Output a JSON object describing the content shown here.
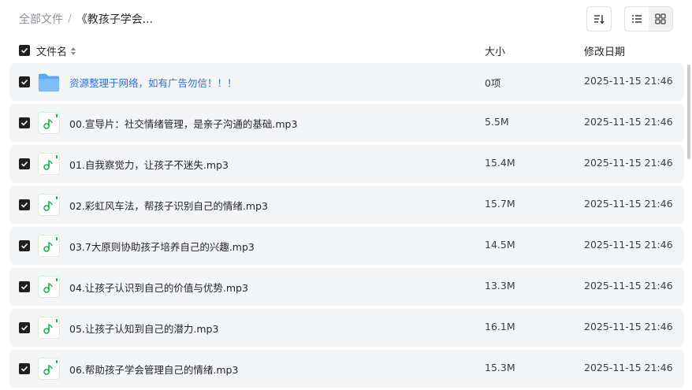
{
  "breadcrumb": {
    "root": "全部文件",
    "separator": "/",
    "current": "《教孩子学会..."
  },
  "toolbar": {
    "sort_icon": "sort-icon",
    "list_view_icon": "list-view-icon",
    "grid_view_icon": "grid-view-icon"
  },
  "columns": {
    "name": "文件名",
    "size": "大小",
    "date": "修改日期"
  },
  "files": [
    {
      "name": "资源整理于网络，如有广告勿信！！！",
      "size": "0项",
      "date": "2025-11-15 21:46",
      "type": "folder"
    },
    {
      "name": "00.宣导片：社交情绪管理，是亲子沟通的基础.mp3",
      "size": "5.5M",
      "date": "2025-11-15 21:46",
      "type": "audio"
    },
    {
      "name": "01.自我察觉力，让孩子不迷失.mp3",
      "size": "15.4M",
      "date": "2025-11-15 21:46",
      "type": "audio"
    },
    {
      "name": "02.彩虹风车法，帮孩子识别自己的情绪.mp3",
      "size": "15.7M",
      "date": "2025-11-15 21:46",
      "type": "audio"
    },
    {
      "name": "03.7大原则协助孩子培养自己的兴趣.mp3",
      "size": "14.5M",
      "date": "2025-11-15 21:46",
      "type": "audio"
    },
    {
      "name": "04.让孩子认识到自己的价值与优势.mp3",
      "size": "13.3M",
      "date": "2025-11-15 21:46",
      "type": "audio"
    },
    {
      "name": "05.让孩子认知到自己的潜力.mp3",
      "size": "16.1M",
      "date": "2025-11-15 21:46",
      "type": "audio"
    },
    {
      "name": "06.帮助孩子学会管理自己的情绪.mp3",
      "size": "15.3M",
      "date": "2025-11-15 21:46",
      "type": "audio"
    }
  ],
  "colors": {
    "folder": "#6fb3f5",
    "audio": "#1fb34f",
    "link": "#2a6fd6",
    "row_bg": "#f4f5f6"
  }
}
